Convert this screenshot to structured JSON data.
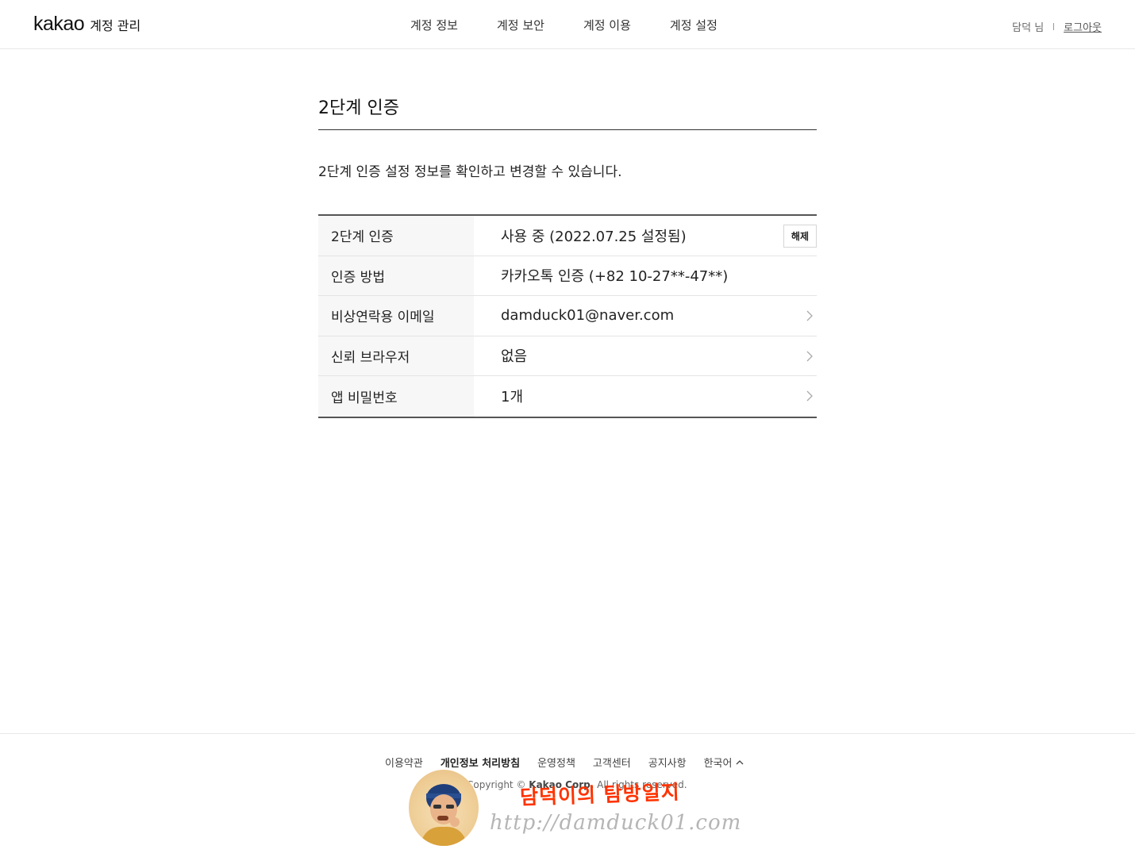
{
  "header": {
    "logo_word": "kakao",
    "logo_sub": "계정 관리",
    "nav": [
      "계정 정보",
      "계정 보안",
      "계정 이용",
      "계정 설정"
    ],
    "user_name": "담덕 님",
    "logout": "로그아웃"
  },
  "main": {
    "title": "2단계 인증",
    "description": "2단계 인증 설정 정보를 확인하고 변경할 수 있습니다.",
    "rows": [
      {
        "label": "2단계 인증",
        "value": "사용 중 (2022.07.25 설정됨)",
        "button": "해제"
      },
      {
        "label": "인증 방법",
        "value": "카카오톡 인증 (+82 10-27**-47**)"
      },
      {
        "label": "비상연락용 이메일",
        "value": "damduck01@naver.com",
        "action_icon": "chevron-right-icon"
      },
      {
        "label": "신뢰 브라우저",
        "value": "없음",
        "action_icon": "chevron-right-icon"
      },
      {
        "label": "앱 비밀번호",
        "value": "1개",
        "action_icon": "chevron-right-icon"
      }
    ]
  },
  "footer": {
    "links": [
      "이용약관",
      "개인정보 처리방침",
      "운영정책",
      "고객센터",
      "공지사항"
    ],
    "language": "한국어",
    "language_icon": "chevron-up-icon",
    "copyright_prefix": "Copyright ©",
    "copyright_company": "Kakao Corp.",
    "copyright_suffix": "All rights reserved."
  },
  "watermark": {
    "title": "담덕이의 탐방일지",
    "url": "http://damduck01.com"
  },
  "colors": {
    "watermark_title": "#ff3300",
    "watermark_url": "#b5b5b5",
    "table_label_bg": "#f7f7f7"
  }
}
